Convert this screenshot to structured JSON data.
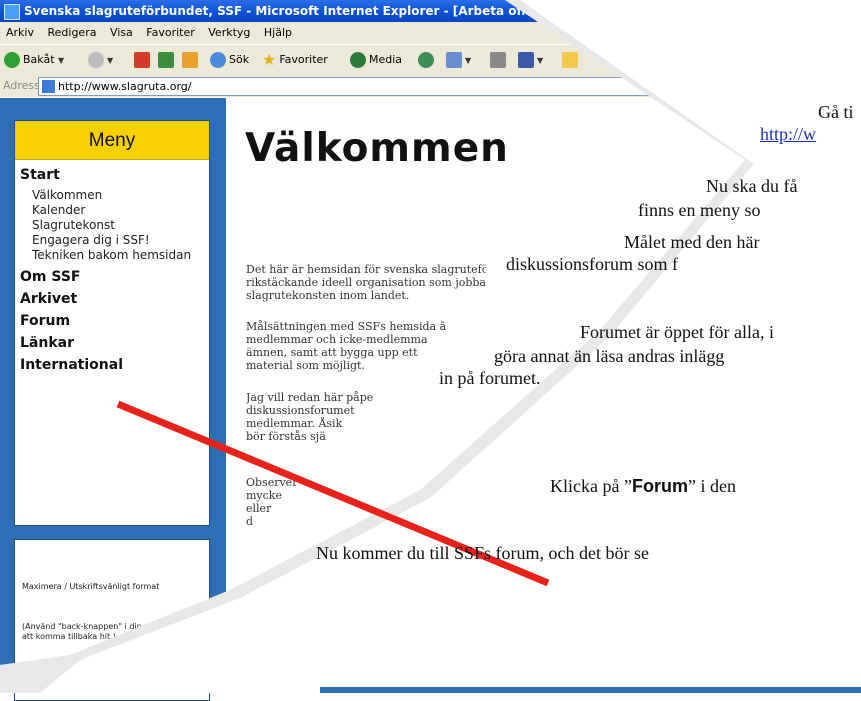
{
  "browser": {
    "window_title": "Svenska slagruteförbundet, SSF - Microsoft Internet Explorer - [Arbeta offline]",
    "menu": [
      "Arkiv",
      "Redigera",
      "Visa",
      "Favoriter",
      "Verktyg",
      "Hjälp"
    ],
    "toolbar": {
      "back_label": "Bakåt",
      "search_label": "Sök",
      "favorites_label": "Favoriter",
      "media_label": "Media"
    },
    "address_label": "Adress",
    "address_value": "http://www.slagruta.org/"
  },
  "site": {
    "menu_title": "Meny",
    "sections": [
      {
        "label": "Start",
        "items": [
          "Välkommen",
          "Kalender",
          "Slagrutekonst",
          "Engagera dig i SSF!",
          "Tekniken bakom hemsidan"
        ]
      },
      {
        "label": "Om SSF"
      },
      {
        "label": "Arkivet"
      },
      {
        "label": "Forum"
      },
      {
        "label": "Länkar"
      },
      {
        "label": "International"
      }
    ],
    "print_box": {
      "text1": "Maximera / Utskriftsvänligt format",
      "text2": "(Använd \"back-knappen\" i din webläsare för att komma tillbaka hit.)"
    },
    "heading": "Välkommen",
    "paragraphs": [
      [
        "Det här är hemsidan för svenska slagruteförbu",
        "rikstäckande ideell organisation som jobbar",
        "slagrutekonsten inom landet."
      ],
      [
        "Målsättningen med SSFs hemsida ä",
        "medlemmar och icke-medlemma",
        "ämnen, samt att bygga upp ett",
        "material som möjligt."
      ],
      [
        "Jag vill redan här påpe",
        "diskussionsforumet",
        "medlemmar. Åsik",
        "bör förstås sjä"
      ],
      [
        "Observer",
        "mycke",
        "eller",
        "d"
      ]
    ]
  },
  "tutorial": {
    "line1": "Gå ti",
    "link": "http://w",
    "line2": "Nu ska du få",
    "line3": "finns en meny so",
    "line4": "Målet med den här",
    "line5": "diskussionsforum som f",
    "line6": "Forumet är öppet för alla, i",
    "line7": "göra annat än läsa andras inlägg",
    "line8": "in på forumet.",
    "click_prefix": "Klicka på ”",
    "click_bold": "Forum",
    "click_suffix": "” i den",
    "line9": "Nu kommer du till SSFs forum, och det bör se"
  },
  "colors": {
    "sidebar_bg": "#2e6eb5",
    "menu_header": "#f7d000",
    "arrow": "#e8221a",
    "link": "#1a2fbf"
  }
}
